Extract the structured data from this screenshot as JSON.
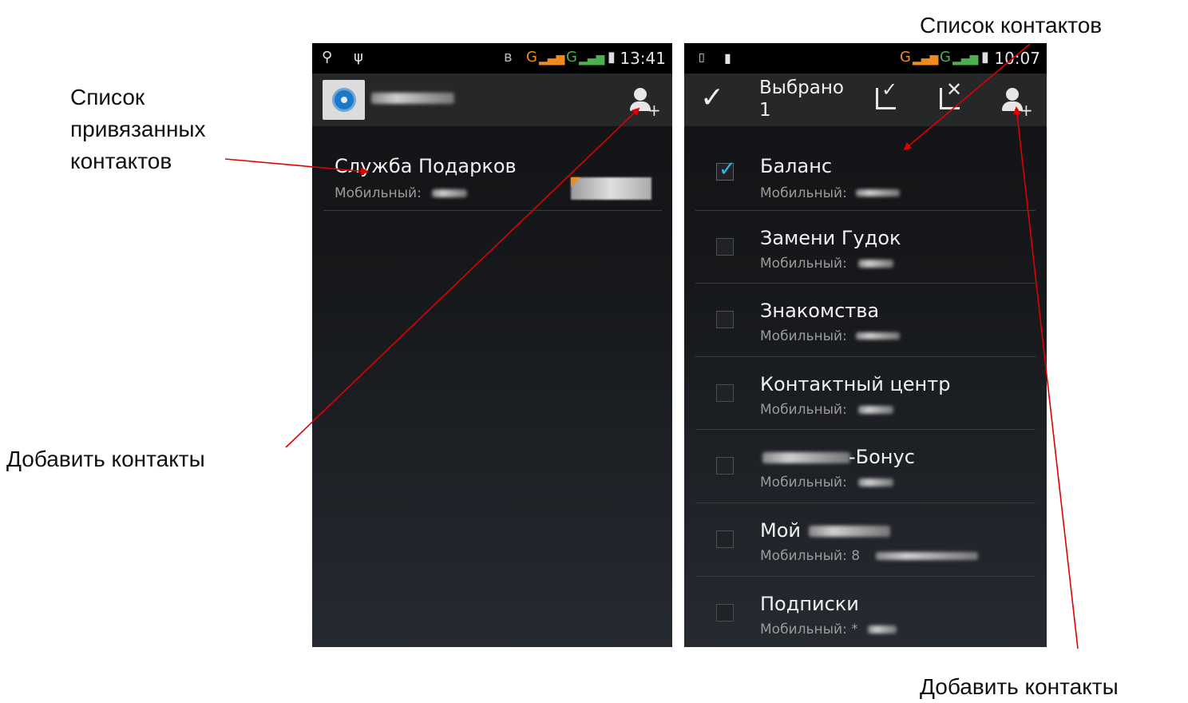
{
  "annotations": {
    "linked_contacts": [
      "Список",
      "привязанных",
      "контактов"
    ],
    "add_contacts_left": "Добавить контакты",
    "contacts_list": "Список контактов",
    "add_contacts_right": "Добавить контакты"
  },
  "left_phone": {
    "status_time": "13:41",
    "status_network": "G",
    "contacts": [
      {
        "name": "Служба Подарков",
        "sub": "Мобильный:"
      }
    ]
  },
  "right_phone": {
    "status_time": "10:07",
    "status_network": "G",
    "selection_title": "Выбрано",
    "selection_count": "1",
    "contacts": [
      {
        "name": "Баланс",
        "sub": "Мобильный:",
        "checked": true
      },
      {
        "name": "Замени Гудок",
        "sub": "Мобильный:",
        "checked": false
      },
      {
        "name": "Знакомства",
        "sub": "Мобильный:",
        "checked": false
      },
      {
        "name": "Контактный центр",
        "sub": "Мобильный:",
        "checked": false
      },
      {
        "name": "-Бонус",
        "sub": "Мобильный:",
        "checked": false
      },
      {
        "name": "Мой",
        "sub": "Мобильный: 8",
        "checked": false
      },
      {
        "name": "Подписки",
        "sub": "Мобильный: *",
        "checked": false
      }
    ]
  },
  "colors": {
    "accent": "#33b5e5",
    "arrow": "#e00000",
    "network_orange": "#f08a1c",
    "network_green": "#4caf50"
  },
  "icons": [
    "search-icon",
    "usb-icon",
    "bluetooth-icon",
    "battery-icon",
    "sim-icon",
    "person-add-icon",
    "check-icon",
    "select-all-icon",
    "deselect-all-icon",
    "settings-icon"
  ]
}
